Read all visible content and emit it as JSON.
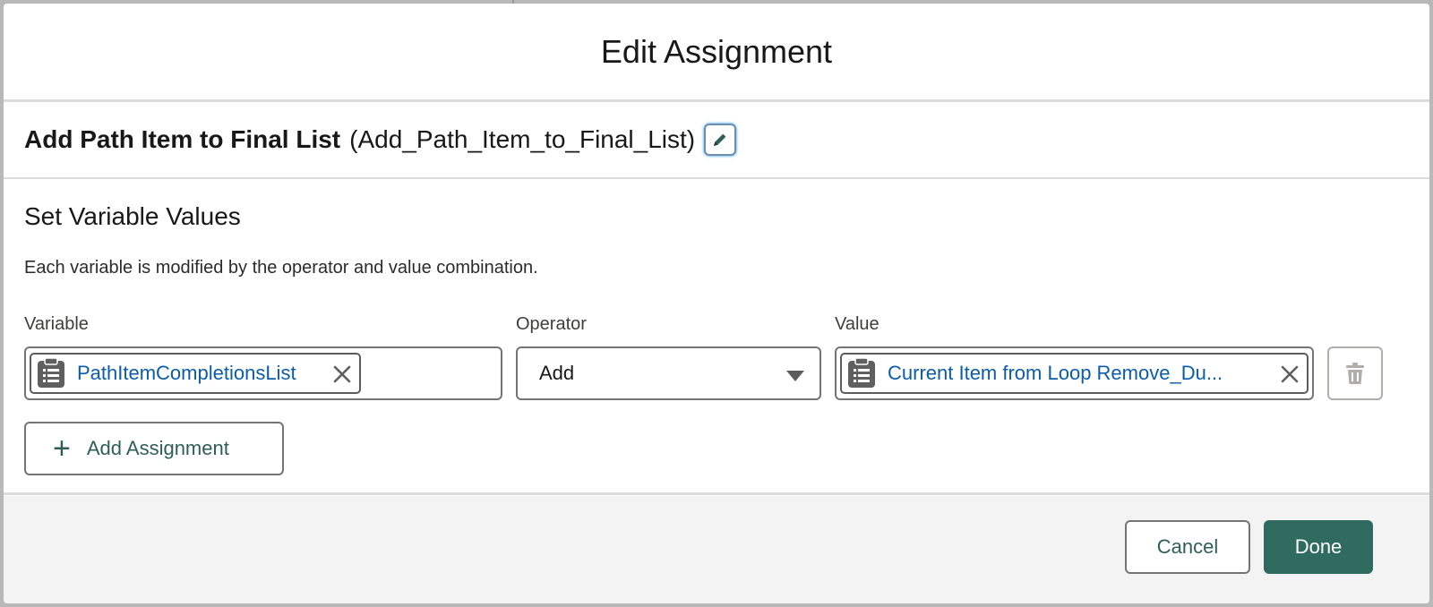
{
  "modal": {
    "title": "Edit Assignment"
  },
  "element": {
    "label": "Add Path Item to Final List",
    "api_name": "(Add_Path_Item_to_Final_List)",
    "edit_icon": "pencil-icon"
  },
  "section": {
    "heading": "Set Variable Values",
    "description": "Each variable is modified by the operator and value combination."
  },
  "fields": {
    "variable_label": "Variable",
    "operator_label": "Operator",
    "value_label": "Value"
  },
  "assignments": [
    {
      "variable": "PathItemCompletionsList",
      "variable_icon": "collection-variable-icon",
      "operator": "Add",
      "value": "Current Item from Loop Remove_Du...",
      "value_icon": "collection-variable-icon"
    }
  ],
  "actions": {
    "add_assignment_label": "Add Assignment",
    "delete_icon": "trash-icon"
  },
  "footer": {
    "cancel_label": "Cancel",
    "done_label": "Done"
  },
  "colors": {
    "brand_button": "#2f6b5f",
    "pill_text": "#0b5cab",
    "border": "#747474"
  }
}
